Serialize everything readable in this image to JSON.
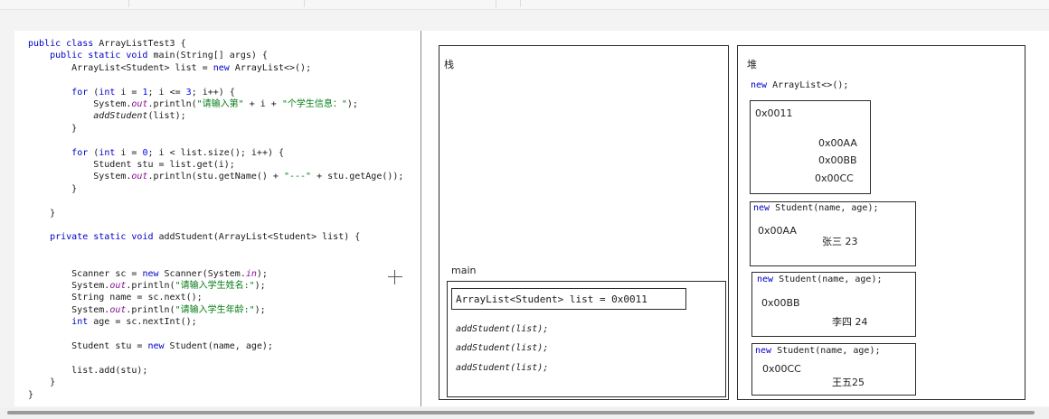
{
  "code": {
    "lines": [
      [
        {
          "t": "public class ",
          "c": "kw"
        },
        {
          "t": "ArrayListTest3 {"
        }
      ],
      [
        {
          "t": "    public static void ",
          "c": "kw"
        },
        {
          "t": "main(String[] args) {"
        }
      ],
      [
        {
          "t": "        ArrayList<Student> list = "
        },
        {
          "t": "new ",
          "c": "kw"
        },
        {
          "t": "ArrayList<>();"
        }
      ],
      [],
      [
        {
          "t": "        "
        },
        {
          "t": "for ",
          "c": "kw"
        },
        {
          "t": "("
        },
        {
          "t": "int ",
          "c": "kw"
        },
        {
          "t": "i = "
        },
        {
          "t": "1",
          "c": "num"
        },
        {
          "t": "; i <= "
        },
        {
          "t": "3",
          "c": "num"
        },
        {
          "t": "; i++) {"
        }
      ],
      [
        {
          "t": "            System."
        },
        {
          "t": "out",
          "c": "fld"
        },
        {
          "t": ".println("
        },
        {
          "t": "\"请输入第\"",
          "c": "str"
        },
        {
          "t": " + i + "
        },
        {
          "t": "\"个学生信息：\"",
          "c": "str"
        },
        {
          "t": ");"
        }
      ],
      [
        {
          "t": "            "
        },
        {
          "t": "addStudent",
          "c": "it"
        },
        {
          "t": "(list);"
        }
      ],
      [
        {
          "t": "        }"
        }
      ],
      [],
      [
        {
          "t": "        "
        },
        {
          "t": "for ",
          "c": "kw"
        },
        {
          "t": "("
        },
        {
          "t": "int ",
          "c": "kw"
        },
        {
          "t": "i = "
        },
        {
          "t": "0",
          "c": "num"
        },
        {
          "t": "; i < list.size(); i++) {"
        }
      ],
      [
        {
          "t": "            Student stu = list.get(i);"
        }
      ],
      [
        {
          "t": "            System."
        },
        {
          "t": "out",
          "c": "fld"
        },
        {
          "t": ".println(stu.getName() + "
        },
        {
          "t": "\"---\"",
          "c": "str"
        },
        {
          "t": " + stu.getAge());"
        }
      ],
      [
        {
          "t": "        }"
        }
      ],
      [],
      [
        {
          "t": "    }"
        }
      ],
      [],
      [
        {
          "t": "    "
        },
        {
          "t": "private static void ",
          "c": "kw"
        },
        {
          "t": "addStudent(ArrayList<Student> list) {"
        }
      ],
      [],
      [],
      [
        {
          "t": "        Scanner sc = "
        },
        {
          "t": "new ",
          "c": "kw"
        },
        {
          "t": "Scanner(System."
        },
        {
          "t": "in",
          "c": "fld"
        },
        {
          "t": ");"
        }
      ],
      [
        {
          "t": "        System."
        },
        {
          "t": "out",
          "c": "fld"
        },
        {
          "t": ".println("
        },
        {
          "t": "\"请输入学生姓名:\"",
          "c": "str"
        },
        {
          "t": ");"
        }
      ],
      [
        {
          "t": "        String name = sc.next();"
        }
      ],
      [
        {
          "t": "        System."
        },
        {
          "t": "out",
          "c": "fld"
        },
        {
          "t": ".println("
        },
        {
          "t": "\"请输入学生年龄:\"",
          "c": "str"
        },
        {
          "t": ");"
        }
      ],
      [
        {
          "t": "        "
        },
        {
          "t": "int ",
          "c": "kw"
        },
        {
          "t": "age = sc.nextInt();"
        }
      ],
      [],
      [
        {
          "t": "        Student stu = "
        },
        {
          "t": "new ",
          "c": "kw"
        },
        {
          "t": "Student(name, age);"
        }
      ],
      [],
      [
        {
          "t": "        list.add(stu);"
        }
      ],
      [
        {
          "t": "    }"
        }
      ],
      [
        {
          "t": "}"
        }
      ]
    ]
  },
  "stack": {
    "title": "栈",
    "frame_label": "main",
    "frame_var": "ArrayList<Student> list = 0x0011",
    "calls": [
      "addStudent(list);",
      "addStudent(list);",
      "addStudent(list);"
    ]
  },
  "heap": {
    "title": "堆",
    "list_new": {
      "kw": "new",
      "rest": "ArrayList<>();"
    },
    "list_obj": {
      "addr": "0x0011",
      "refs": [
        "0x00AA",
        "0x00BB",
        "0x00CC"
      ]
    },
    "students": [
      {
        "kw": "new",
        "ctor": "Student(name, age);",
        "addr": "0x00AA",
        "name": "张三",
        "age": "23"
      },
      {
        "kw": "new",
        "ctor": "Student(name, age);",
        "addr": "0x00BB",
        "name": "李四",
        "age": "24"
      },
      {
        "kw": "new",
        "ctor": "Student(name, age);",
        "addr": "0x00CC",
        "name": "王五",
        "age": "25"
      }
    ]
  },
  "colors": {
    "keyword": "#0000c8",
    "string": "#067d17",
    "number": "#0000ff",
    "field": "#871094"
  }
}
